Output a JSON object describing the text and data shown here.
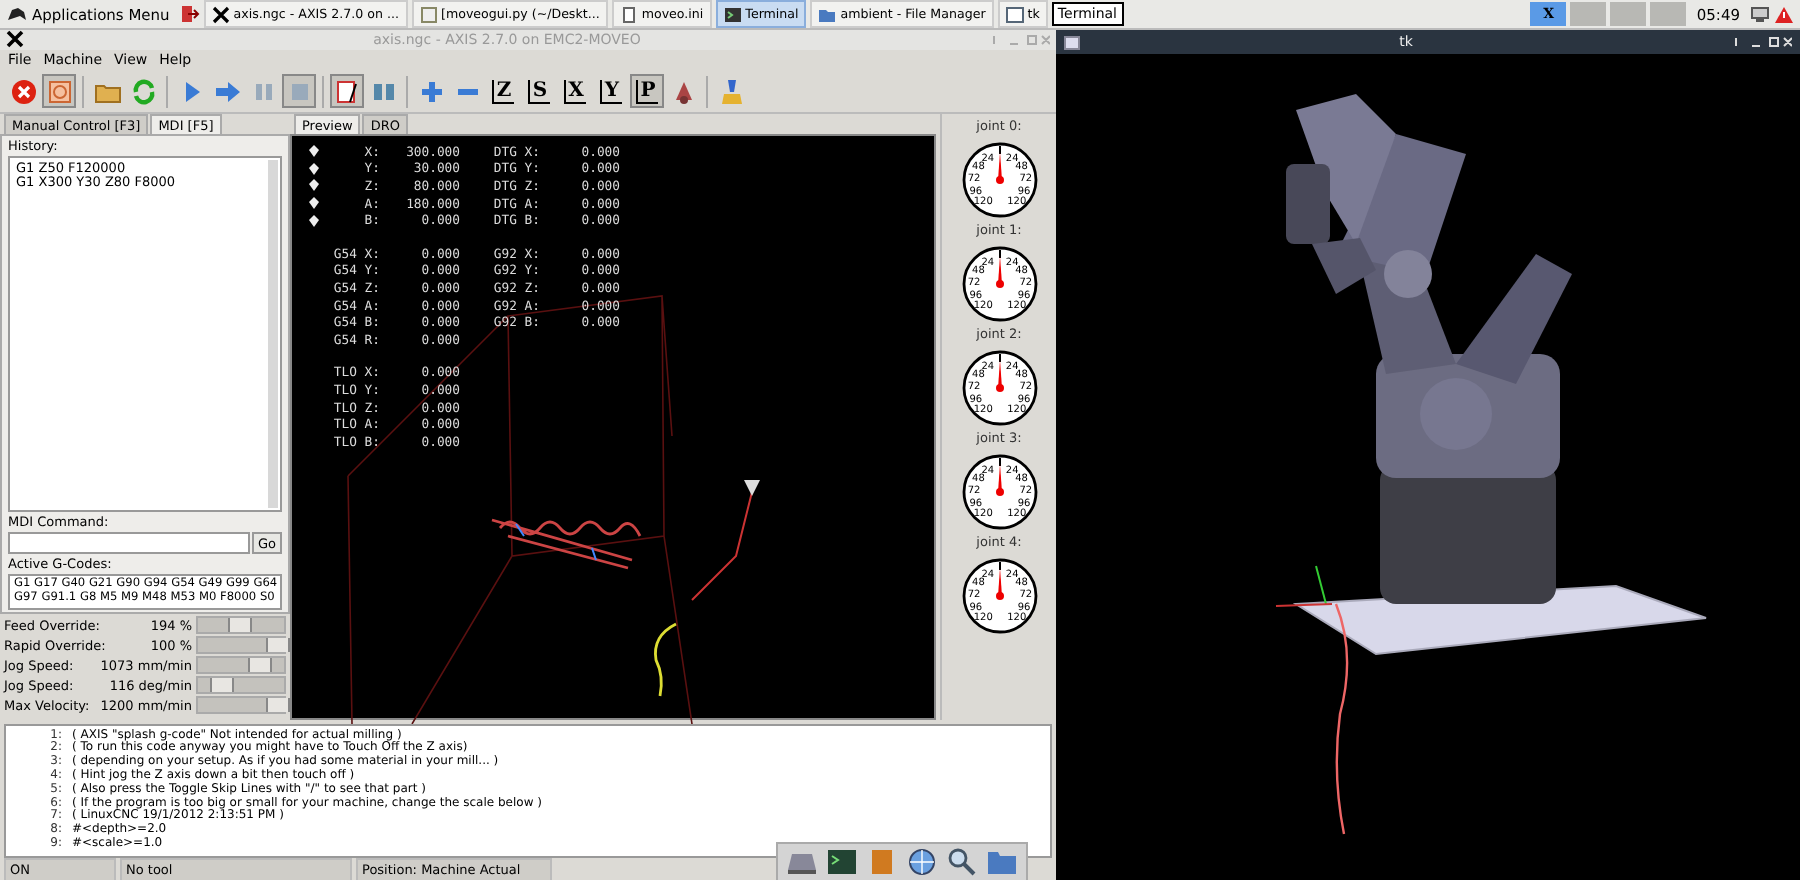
{
  "taskbar": {
    "apps_menu": "Applications Menu",
    "tasks": [
      {
        "kind": "axis",
        "label": "axis.ngc - AXIS 2.7.0 on ...",
        "selected": false
      },
      {
        "kind": "editor",
        "label": "[moveogui.py (~/Deskt...",
        "selected": false
      },
      {
        "kind": "file",
        "label": "moveo.ini",
        "selected": false
      },
      {
        "kind": "terminal",
        "label": "Terminal",
        "selected": true
      },
      {
        "kind": "folder",
        "label": "ambient - File Manager",
        "selected": false
      },
      {
        "kind": "window",
        "label": "tk",
        "selected": false
      }
    ],
    "tooltip": "Terminal",
    "workspaces": [
      {
        "label": "X",
        "selected": true
      },
      {
        "selected": false
      },
      {
        "selected": false
      },
      {
        "selected": false
      }
    ],
    "clock": "05:49"
  },
  "axis_window": {
    "title": "axis.ngc - AXIS 2.7.0 on EMC2-MOVEO",
    "menu": [
      "File",
      "Machine",
      "View",
      "Help"
    ],
    "toolbar": [
      {
        "kind": "estop",
        "on": false
      },
      {
        "kind": "power",
        "on": true
      },
      {
        "kind": "sep"
      },
      {
        "kind": "open",
        "on": false
      },
      {
        "kind": "reload",
        "on": false
      },
      {
        "kind": "sep"
      },
      {
        "kind": "run",
        "on": false
      },
      {
        "kind": "step",
        "on": false
      },
      {
        "kind": "pause",
        "on": false
      },
      {
        "kind": "stop",
        "on": true
      },
      {
        "kind": "sep"
      },
      {
        "kind": "skip",
        "on": true
      },
      {
        "kind": "optstop",
        "on": false
      },
      {
        "kind": "sep"
      },
      {
        "kind": "zoomin",
        "on": false
      },
      {
        "kind": "zoomout",
        "on": false
      },
      {
        "kind": "view",
        "glyph": "Z",
        "on": false
      },
      {
        "kind": "view",
        "glyph": "S",
        "on": false
      },
      {
        "kind": "view",
        "glyph": "X",
        "on": false
      },
      {
        "kind": "view",
        "glyph": "Y",
        "on": false
      },
      {
        "kind": "view",
        "glyph": "P",
        "on": true
      },
      {
        "kind": "rotate",
        "on": false
      },
      {
        "kind": "sep"
      },
      {
        "kind": "clear",
        "on": false
      }
    ],
    "left_tabs": [
      {
        "label": "Manual Control [F3]",
        "selected": false
      },
      {
        "label": "MDI [F5]",
        "selected": true
      }
    ],
    "history_label": "History:",
    "history": [
      "G1 Z50 F120000",
      "G1 X300 Y30 Z80 F8000"
    ],
    "mdi_label": "MDI Command:",
    "go_button": "Go",
    "gcodes_label": "Active G-Codes:",
    "gcodes": [
      "G1 G17 G40 G21 G90 G94 G54 G49 G99 G64",
      "G97 G91.1 G8 M5 M9 M48 M53 M0 F8000 S0"
    ],
    "overrides": [
      {
        "label": "Feed Override:",
        "reading": "194 %",
        "level": 0.45
      },
      {
        "label": "Rapid Override:",
        "reading": "100 %",
        "level": 1
      },
      {
        "label": "Jog Speed:",
        "reading": "1073 mm/min",
        "level": 0.75
      },
      {
        "label": "Jog Speed:",
        "reading": "116 deg/min",
        "level": 0.18
      },
      {
        "label": "Max Velocity:",
        "reading": "1200 mm/min",
        "level": 1
      }
    ],
    "preview_tabs": [
      {
        "label": "Preview",
        "selected": true
      },
      {
        "label": "DRO",
        "selected": false
      }
    ],
    "dro": [
      {
        "rows": [
          {
            "homed": true,
            "label": "X:",
            "value": "300.000",
            "label2": "DTG X:",
            "value2": "0.000"
          },
          {
            "homed": true,
            "label": "Y:",
            "value": "30.000",
            "label2": "DTG Y:",
            "value2": "0.000"
          },
          {
            "homed": true,
            "label": "Z:",
            "value": "80.000",
            "label2": "DTG Z:",
            "value2": "0.000"
          },
          {
            "homed": true,
            "label": "A:",
            "value": "180.000",
            "label2": "DTG A:",
            "value2": "0.000"
          },
          {
            "homed": true,
            "label": "B:",
            "value": "0.000",
            "label2": "DTG B:",
            "value2": "0.000"
          }
        ]
      },
      {
        "rows": [
          {
            "label": "G54 X:",
            "value": "0.000",
            "label2": "G92 X:",
            "value2": "0.000"
          },
          {
            "label": "G54 Y:",
            "value": "0.000",
            "label2": "G92 Y:",
            "value2": "0.000"
          },
          {
            "label": "G54 Z:",
            "value": "0.000",
            "label2": "G92 Z:",
            "value2": "0.000"
          },
          {
            "label": "G54 A:",
            "value": "0.000",
            "label2": "G92 A:",
            "value2": "0.000"
          },
          {
            "label": "G54 B:",
            "value": "0.000",
            "label2": "G92 B:",
            "value2": "0.000"
          },
          {
            "label": "G54 R:",
            "value": "0.000"
          }
        ]
      },
      {
        "rows": [
          {
            "label": "TLO X:",
            "value": "0.000"
          },
          {
            "label": "TLO Y:",
            "value": "0.000"
          },
          {
            "label": "TLO Z:",
            "value": "0.000"
          },
          {
            "label": "TLO A:",
            "value": "0.000"
          },
          {
            "label": "TLO B:",
            "value": "0.000"
          }
        ]
      }
    ],
    "joints": [
      {
        "label": "joint 0:",
        "dial_labels": [
          "24",
          "24",
          "48",
          "48",
          "72",
          "72",
          "96",
          "96",
          "120",
          "120"
        ]
      },
      {
        "label": "joint 1:",
        "dial_labels": [
          "24",
          "24",
          "48",
          "48",
          "72",
          "72",
          "96",
          "96",
          "120",
          "120"
        ]
      },
      {
        "label": "joint 2:",
        "dial_labels": [
          "24",
          "24",
          "48",
          "48",
          "72",
          "72",
          "96",
          "96",
          "120",
          "120"
        ]
      },
      {
        "label": "joint 3:",
        "dial_labels": [
          "24",
          "24",
          "48",
          "48",
          "72",
          "72",
          "96",
          "96",
          "120",
          "120"
        ]
      },
      {
        "label": "joint 4:",
        "dial_labels": [
          "24",
          "24",
          "48",
          "48",
          "72",
          "72",
          "96",
          "96",
          "120",
          "120"
        ]
      }
    ],
    "code": [
      {
        "number": "1:",
        "text": "( AXIS \"splash g-code\" Not intended for actual milling )"
      },
      {
        "number": "2:",
        "text": "( To run this code anyway you might have to Touch Off the Z axis)"
      },
      {
        "number": "3:",
        "text": "( depending on your setup. As if you had some material in your mill... )"
      },
      {
        "number": "4:",
        "text": "( Hint jog the Z axis down a bit then touch off )"
      },
      {
        "number": "5:",
        "text": "( Also press the Toggle Skip Lines with \"/\" to see that part )"
      },
      {
        "number": "6:",
        "text": "( If the program is too big or small for your machine, change the scale below )"
      },
      {
        "number": "7:",
        "text": "( LinuxCNC 19/1/2012 2:13:51 PM )"
      },
      {
        "number": "8:",
        "text": "#<depth>=2.0"
      },
      {
        "number": "9:",
        "text": "#<scale>=1.0"
      }
    ],
    "status_bar": [
      "ON",
      "No tool",
      "Position: Machine Actual"
    ]
  },
  "tk_window": {
    "title": "tk"
  }
}
